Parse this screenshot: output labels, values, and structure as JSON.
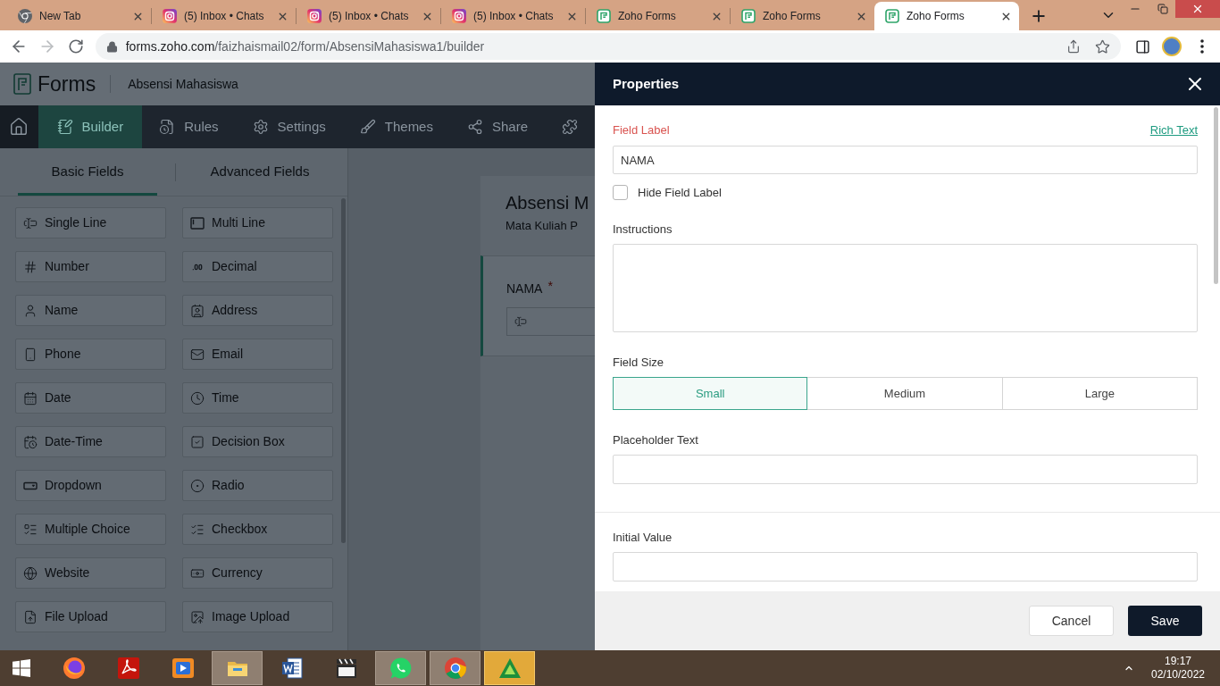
{
  "browser": {
    "tabs": [
      {
        "kind": "chrome",
        "title": "New Tab",
        "selected": false
      },
      {
        "kind": "instagram",
        "title": "(5) Inbox • Chats",
        "selected": false
      },
      {
        "kind": "instagram",
        "title": "(5) Inbox • Chats",
        "selected": false
      },
      {
        "kind": "instagram",
        "title": "(5) Inbox • Chats",
        "selected": false
      },
      {
        "kind": "zoho",
        "title": "Zoho Forms",
        "selected": false
      },
      {
        "kind": "zoho",
        "title": "Zoho Forms",
        "selected": false
      },
      {
        "kind": "zoho",
        "title": "Zoho Forms",
        "selected": true
      }
    ],
    "nav_buttons": [
      {
        "kind": "back",
        "disabled": false
      },
      {
        "kind": "forward",
        "disabled": true
      },
      {
        "kind": "reload",
        "disabled": false
      }
    ],
    "url_host": "forms.zoho.com",
    "url_path": "/faizhaismail02/form/AbsensiMahasiswa1/builder"
  },
  "app": {
    "brand": "Forms",
    "form_name": "Absensi Mahasiswa",
    "nav": [
      {
        "kind": "home",
        "selected": false
      },
      {
        "kind": "builder",
        "label": "Builder",
        "selected": true
      },
      {
        "kind": "rules",
        "label": "Rules",
        "selected": false
      },
      {
        "kind": "settings",
        "label": "Settings",
        "selected": false
      },
      {
        "kind": "themes",
        "label": "Themes",
        "selected": false
      },
      {
        "kind": "share",
        "label": "Share",
        "selected": false
      },
      {
        "kind": "integrations",
        "selected": false
      }
    ],
    "field_tabs": [
      {
        "label": "Basic Fields",
        "selected": true
      },
      {
        "label": "Advanced Fields",
        "selected": false
      }
    ],
    "fields": [
      {
        "kind": "single_line",
        "label": "Single Line"
      },
      {
        "kind": "multi_line",
        "label": "Multi Line"
      },
      {
        "kind": "number",
        "label": "Number"
      },
      {
        "kind": "decimal",
        "label": "Decimal"
      },
      {
        "kind": "name",
        "label": "Name"
      },
      {
        "kind": "address",
        "label": "Address"
      },
      {
        "kind": "phone",
        "label": "Phone"
      },
      {
        "kind": "email",
        "label": "Email"
      },
      {
        "kind": "date",
        "label": "Date"
      },
      {
        "kind": "time",
        "label": "Time"
      },
      {
        "kind": "date_time",
        "label": "Date-Time"
      },
      {
        "kind": "decision_box",
        "label": "Decision Box"
      },
      {
        "kind": "dropdown",
        "label": "Dropdown"
      },
      {
        "kind": "radio",
        "label": "Radio"
      },
      {
        "kind": "multiple_choice",
        "label": "Multiple Choice"
      },
      {
        "kind": "checkbox",
        "label": "Checkbox"
      },
      {
        "kind": "website",
        "label": "Website"
      },
      {
        "kind": "currency",
        "label": "Currency"
      },
      {
        "kind": "file_upload",
        "label": "File Upload"
      },
      {
        "kind": "image_upload",
        "label": "Image Upload"
      }
    ],
    "canvas": {
      "title": "Absensi M",
      "subtitle": "Mata Kuliah P",
      "field": {
        "label": "NAMA",
        "required_mark": "*"
      }
    }
  },
  "properties": {
    "title": "Properties",
    "field_label": {
      "label": "Field Label",
      "rich_text": "Rich Text",
      "value": "NAMA"
    },
    "hide_label": {
      "label": "Hide Field Label",
      "checked": false
    },
    "instructions": {
      "label": "Instructions"
    },
    "field_size": {
      "label": "Field Size",
      "options": [
        {
          "label": "Small",
          "selected": true
        },
        {
          "label": "Medium",
          "selected": false
        },
        {
          "label": "Large",
          "selected": false
        }
      ]
    },
    "placeholder_text": {
      "label": "Placeholder Text"
    },
    "initial_value": {
      "label": "Initial Value"
    },
    "buttons": [
      {
        "kind": "secondary",
        "label": "Cancel"
      },
      {
        "kind": "primary",
        "label": "Save"
      }
    ]
  },
  "taskbar": {
    "apps": [
      {
        "kind": "firefox",
        "running": false,
        "attention": false
      },
      {
        "kind": "acrobat",
        "running": false,
        "attention": false
      },
      {
        "kind": "media_player",
        "running": false,
        "attention": false
      },
      {
        "kind": "explorer",
        "running": true,
        "attention": false
      },
      {
        "kind": "word",
        "running": false,
        "attention": false
      },
      {
        "kind": "mpc",
        "running": false,
        "attention": false
      },
      {
        "kind": "whatsapp",
        "running": true,
        "attention": false
      },
      {
        "kind": "chrome",
        "running": true,
        "attention": false
      },
      {
        "kind": "triangle",
        "running": true,
        "attention": true
      }
    ],
    "time": "19:17",
    "date": "02/10/2022"
  }
}
